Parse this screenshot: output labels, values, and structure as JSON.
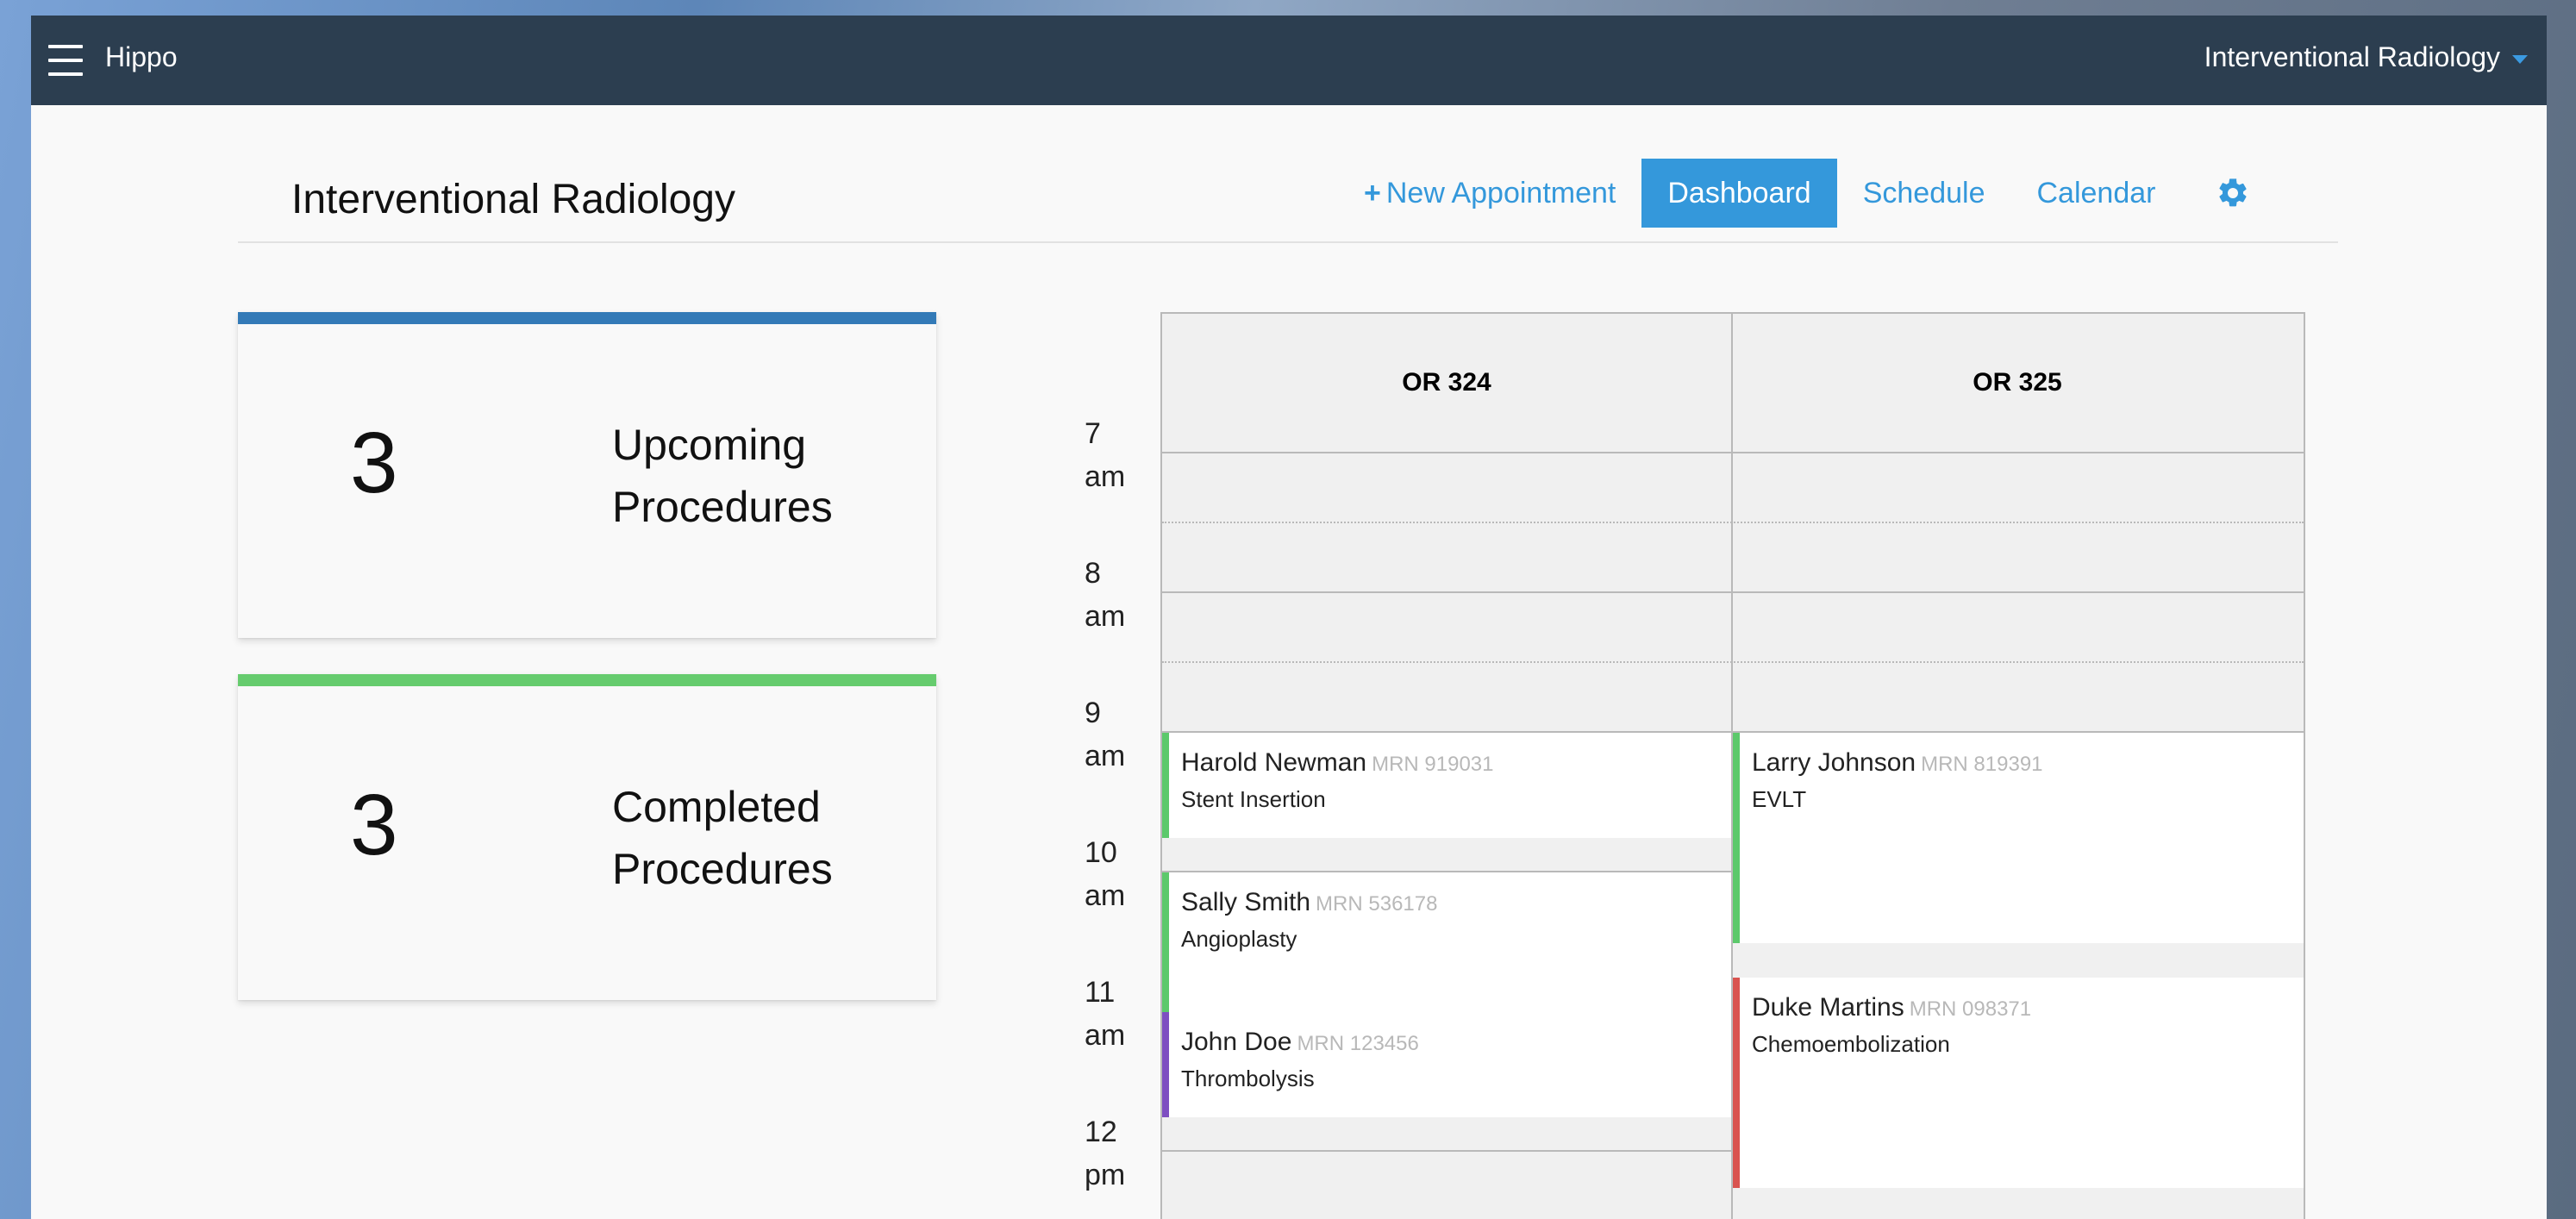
{
  "app": {
    "brand": "Hippo",
    "department": "Interventional Radiology"
  },
  "header": {
    "title": "Interventional Radiology",
    "new_appointment": "New Appointment",
    "dashboard": "Dashboard",
    "schedule": "Schedule",
    "calendar": "Calendar"
  },
  "stats": {
    "upcoming": {
      "count": "3",
      "line1": "Upcoming",
      "line2": "Procedures",
      "color": "#337ab7"
    },
    "completed": {
      "count": "3",
      "line1": "Completed",
      "line2": "Procedures",
      "color": "#66cc6e"
    }
  },
  "times": [
    {
      "hour": "7",
      "period": "am"
    },
    {
      "hour": "8",
      "period": "am"
    },
    {
      "hour": "9",
      "period": "am"
    },
    {
      "hour": "10",
      "period": "am"
    },
    {
      "hour": "11",
      "period": "am"
    },
    {
      "hour": "12",
      "period": "pm"
    }
  ],
  "rooms": [
    "OR 324",
    "OR 325"
  ],
  "appointments": [
    {
      "name": "Harold Newman",
      "mrn": "MRN 919031",
      "procedure": "Stent Insertion",
      "color": "#5cc96b"
    },
    {
      "name": "Sally Smith",
      "mrn": "MRN 536178",
      "procedure": "Angioplasty",
      "color": "#5cc96b"
    },
    {
      "name": "John Doe",
      "mrn": "MRN 123456",
      "procedure": "Thrombolysis",
      "color": "#7e4fc1"
    },
    {
      "name": "Larry Johnson",
      "mrn": "MRN 819391",
      "procedure": "EVLT",
      "color": "#5cc96b"
    },
    {
      "name": "Duke Martins",
      "mrn": "MRN 098371",
      "procedure": "Chemoembolization",
      "color": "#d9534f"
    }
  ]
}
